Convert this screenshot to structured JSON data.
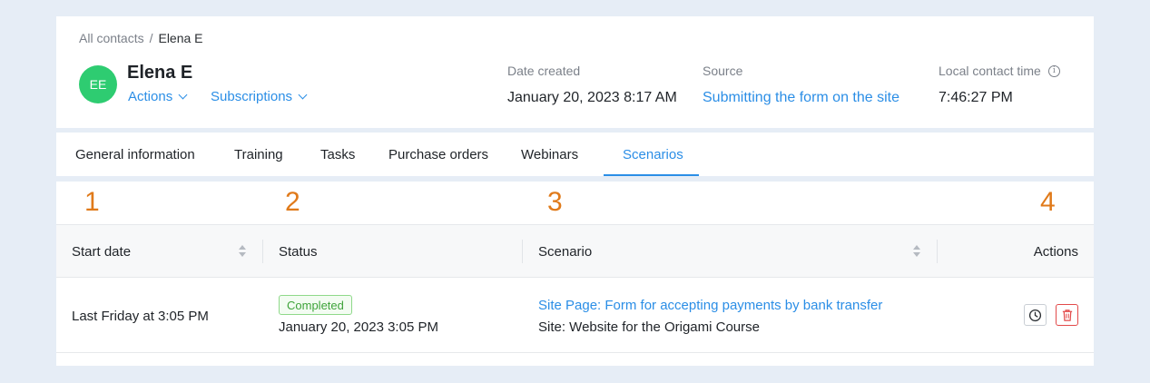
{
  "breadcrumb": {
    "root": "All contacts",
    "separator": "/",
    "current": "Elena E"
  },
  "contact": {
    "initials": "EE",
    "name": "Elena E",
    "avatar_color": "#2ecc71",
    "actions_label": "Actions",
    "subscriptions_label": "Subscriptions"
  },
  "meta": {
    "date_created_label": "Date created",
    "date_created_value": "January 20, 2023 8:17 AM",
    "source_label": "Source",
    "source_value": "Submitting the form on the site",
    "local_time_label": "Local contact time",
    "local_time_value": "7:46:27 PM"
  },
  "tabs": [
    {
      "label": "General information"
    },
    {
      "label": "Training"
    },
    {
      "label": "Tasks"
    },
    {
      "label": "Purchase orders"
    },
    {
      "label": "Webinars"
    },
    {
      "label": "Scenarios",
      "active": true
    }
  ],
  "annotations": [
    "1",
    "2",
    "3",
    "4"
  ],
  "table": {
    "columns": [
      "Start date",
      "Status",
      "Scenario",
      "Actions"
    ],
    "rows": [
      {
        "start_date": "Last Friday at 3:05 PM",
        "status": "Completed",
        "status_date": "January 20, 2023 3:05 PM",
        "scenario_link": "Site Page: Form for accepting payments by bank transfer",
        "scenario_site": "Site: Website for the Origami Course"
      }
    ]
  },
  "colors": {
    "accent": "#2b8ee6",
    "annotation": "#e07a1a",
    "success": "#3ea33a",
    "danger": "#e24a4a"
  },
  "icons": {
    "history": "history-icon",
    "delete": "trash-icon",
    "info": "info-icon"
  }
}
